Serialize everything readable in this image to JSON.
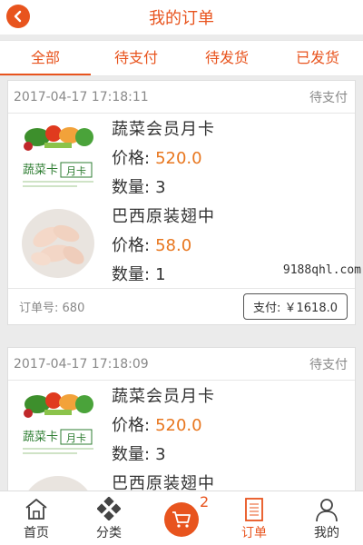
{
  "header": {
    "title": "我的订单"
  },
  "tabs": [
    {
      "label": "全部",
      "active": true
    },
    {
      "label": "待支付",
      "active": false
    },
    {
      "label": "待发货",
      "active": false
    },
    {
      "label": "已发货",
      "active": false
    }
  ],
  "orders": [
    {
      "time": "2017-04-17 17:18:11",
      "status": "待支付",
      "items": [
        {
          "name": "蔬菜会员月卡",
          "price_label": "价格:",
          "price": "520.0",
          "qty_label": "数量:",
          "qty": "3",
          "image": "vegetable-card-image"
        },
        {
          "name": "巴西原装翅中",
          "price_label": "价格:",
          "price": "58.0",
          "qty_label": "数量:",
          "qty": "1",
          "image": "chicken-wings-image"
        }
      ],
      "order_no_label": "订单号:",
      "order_no": "680",
      "pay_label": "支付: ￥1618.0"
    },
    {
      "time": "2017-04-17 17:18:09",
      "status": "待支付",
      "items": [
        {
          "name": "蔬菜会员月卡",
          "price_label": "价格:",
          "price": "520.0",
          "qty_label": "数量:",
          "qty": "3",
          "image": "vegetable-card-image"
        },
        {
          "name": "巴西原装翅中",
          "image": "chicken-wings-image"
        }
      ]
    }
  ],
  "watermark": "9188qhl.com",
  "bottom_nav": [
    {
      "label": "首页",
      "icon": "home-icon"
    },
    {
      "label": "分类",
      "icon": "category-icon"
    },
    {
      "label": "",
      "icon": "cart-icon",
      "badge": "2"
    },
    {
      "label": "订单",
      "icon": "order-icon",
      "active": true
    },
    {
      "label": "我的",
      "icon": "user-icon"
    }
  ],
  "colors": {
    "accent": "#e8541e",
    "price": "#e8761e"
  },
  "card_image_text": {
    "main": "蔬菜卡",
    "sub": "月卡"
  }
}
